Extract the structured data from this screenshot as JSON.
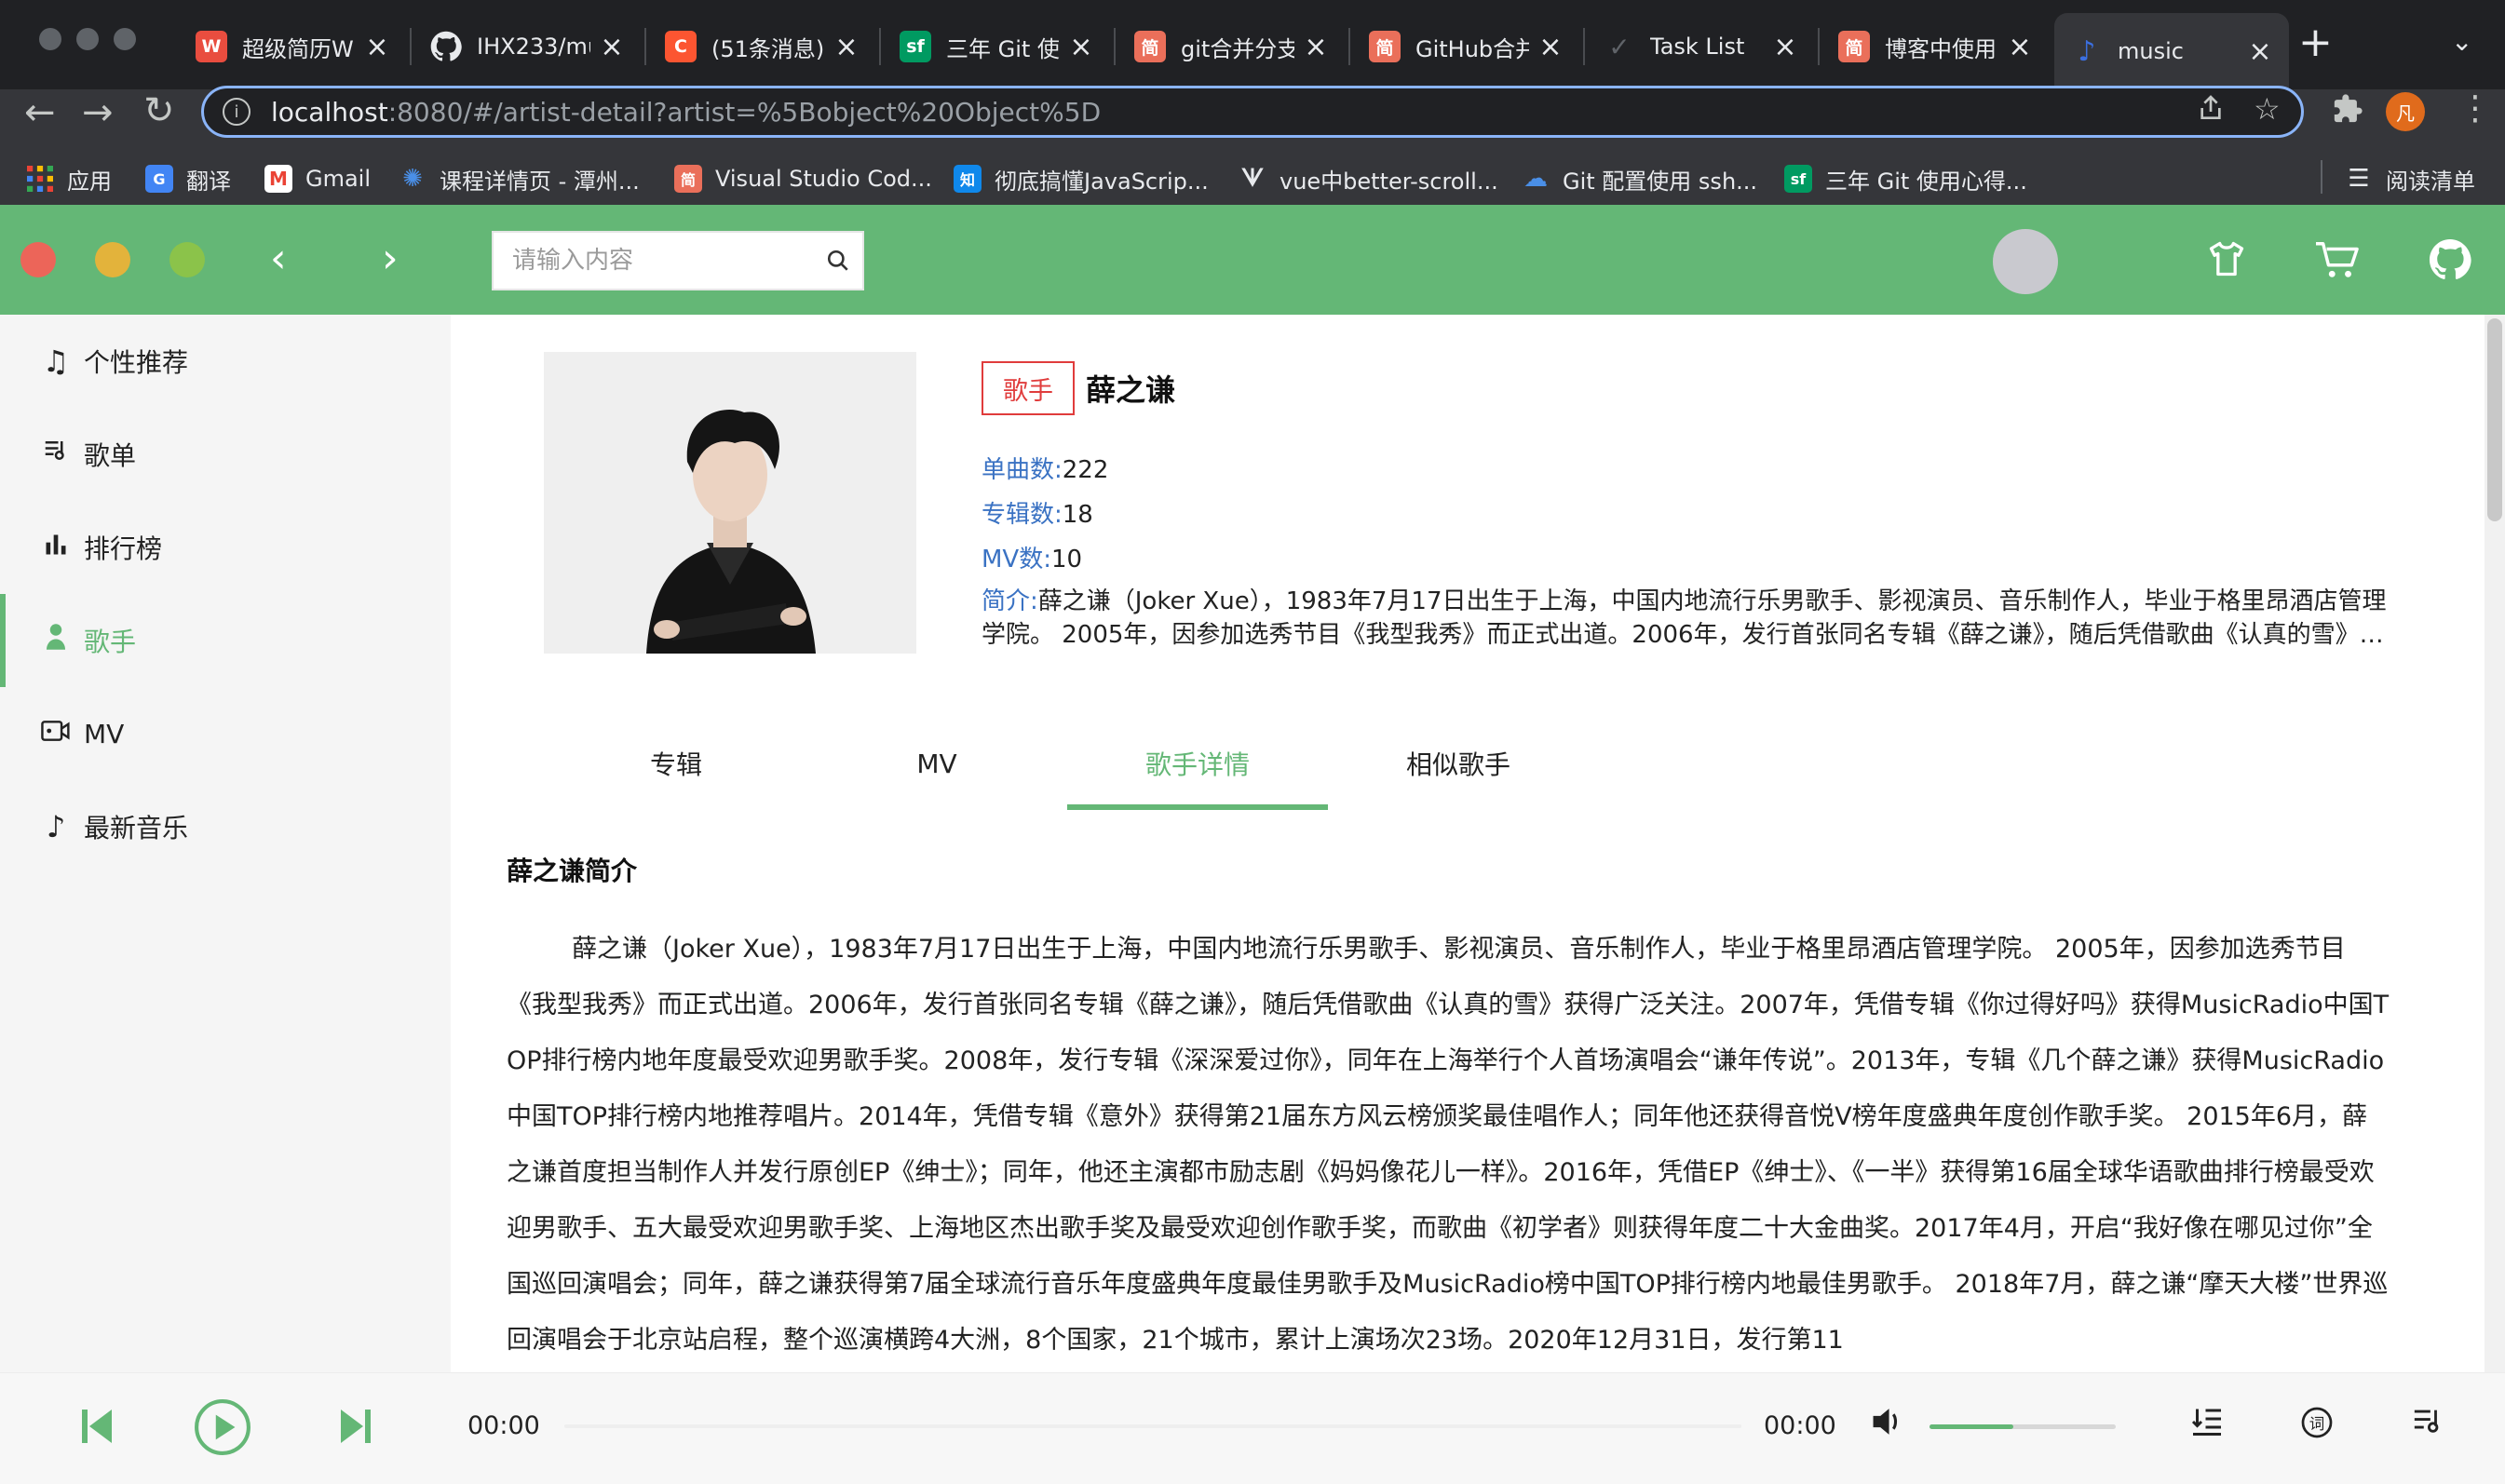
{
  "browser": {
    "tabs": [
      {
        "label": "超级简历W",
        "favicon": "W",
        "color": "#e94d3f"
      },
      {
        "label": "IHX233/mu",
        "favicon": "github-icon",
        "color": "#24292e"
      },
      {
        "label": "(51条消息)",
        "favicon": "C",
        "color": "#fc5531"
      },
      {
        "label": "三年 Git 使",
        "favicon": "sf",
        "color": "#009a61"
      },
      {
        "label": "git合并分支",
        "favicon": "简",
        "color": "#ea6f5a"
      },
      {
        "label": "GitHub合并",
        "favicon": "简",
        "color": "#ea6f5a"
      },
      {
        "label": "Task List",
        "favicon": "check-icon",
        "color": "#5f6368"
      },
      {
        "label": "博客中使用",
        "favicon": "简",
        "color": "#ea6f5a"
      },
      {
        "label": "music",
        "favicon": "music-icon",
        "color": "#3b6fe0"
      }
    ],
    "url_host": "localhost",
    "url_rest": ":8080/#/artist-detail?artist=%5Bobject%20Object%5D",
    "profile_initial": "凡",
    "bookmarks": [
      {
        "label": "应用",
        "icon": "apps-grid-icon"
      },
      {
        "label": "翻译",
        "icon": "translate-icon"
      },
      {
        "label": "Gmail",
        "icon": "gmail-icon"
      },
      {
        "label": "课程详情页 - 潭州...",
        "icon": "course-icon"
      },
      {
        "label": "Visual Studio Cod...",
        "icon": "简"
      },
      {
        "label": "彻底搞懂JavaScrip...",
        "icon": "知"
      },
      {
        "label": "vue中better-scroll...",
        "icon": "vue-icon"
      },
      {
        "label": "Git 配置使用 ssh...",
        "icon": "cloud-icon"
      },
      {
        "label": "三年 Git 使用心得...",
        "icon": "sf"
      }
    ],
    "reading_list": "阅读清单"
  },
  "header": {
    "search_placeholder": "请输入内容"
  },
  "sidebar": {
    "items": [
      {
        "label": "个性推荐",
        "icon": "music-note-icon"
      },
      {
        "label": "歌单",
        "icon": "playlist-icon"
      },
      {
        "label": "排行榜",
        "icon": "bar-chart-icon"
      },
      {
        "label": "歌手",
        "icon": "person-icon"
      },
      {
        "label": "MV",
        "icon": "video-camera-icon"
      },
      {
        "label": "最新音乐",
        "icon": "music-note-icon"
      }
    ],
    "active_index": 3
  },
  "artist": {
    "badge": "歌手",
    "name": "薛之谦",
    "singles_label": "单曲数:",
    "singles": "222",
    "albums_label": "专辑数:",
    "albums": "18",
    "mv_label": "MV数:",
    "mv": "10",
    "intro_label": "简介:",
    "intro": "薛之谦（Joker Xue），1983年7月17日出生于上海，中国内地流行乐男歌手、影视演员、音乐制作人，毕业于格里昂酒店管理学院。 2005年，因参加选秀节目《我型我秀》而正式出道。2006年，发行首张同名专辑《薛之谦》，随后凭借歌曲《认真的雪》获得广泛关注。"
  },
  "tabs": {
    "items": [
      "专辑",
      "MV",
      "歌手详情",
      "相似歌手"
    ],
    "active_index": 2
  },
  "bio": {
    "title": "薛之谦简介",
    "text": "薛之谦（Joker Xue），1983年7月17日出生于上海，中国内地流行乐男歌手、影视演员、音乐制作人，毕业于格里昂酒店管理学院。 2005年，因参加选秀节目《我型我秀》而正式出道。2006年，发行首张同名专辑《薛之谦》，随后凭借歌曲《认真的雪》获得广泛关注。2007年，凭借专辑《你过得好吗》获得MusicRadio中国TOP排行榜内地年度最受欢迎男歌手奖。2008年，发行专辑《深深爱过你》，同年在上海举行个人首场演唱会“谦年传说”。2013年，专辑《几个薛之谦》获得MusicRadio中国TOP排行榜内地推荐唱片。2014年，凭借专辑《意外》获得第21届东方风云榜颁奖最佳唱作人；同年他还获得音悦V榜年度盛典年度创作歌手奖。 2015年6月，薛之谦首度担当制作人并发行原创EP《绅士》；同年，他还主演都市励志剧《妈妈像花儿一样》。2016年，凭借EP《绅士》、《一半》获得第16届全球华语歌曲排行榜最受欢迎男歌手、五大最受欢迎男歌手奖、上海地区杰出歌手奖及最受欢迎创作歌手奖，而歌曲《初学者》则获得年度二十大金曲奖。2017年4月，开启“我好像在哪见过你”全国巡回演唱会；同年，薛之谦获得第7届全球流行音乐年度盛典年度最佳男歌手及MusicRadio榜中国TOP排行榜内地最佳男歌手。 2018年7月，薛之谦“摩天大楼”世界巡回演唱会于北京站启程，整个巡演横跨4大洲，8个国家，21个城市，累计上演场次23场。2020年12月31日，发行第11"
  },
  "player": {
    "current_time": "00:00",
    "total_time": "00:00",
    "volume_fraction": 0.45
  },
  "colors": {
    "accent": "#64b776",
    "mac_red": "#ec6559",
    "mac_yellow": "#e3b33b",
    "mac_green": "#8bc34a"
  }
}
